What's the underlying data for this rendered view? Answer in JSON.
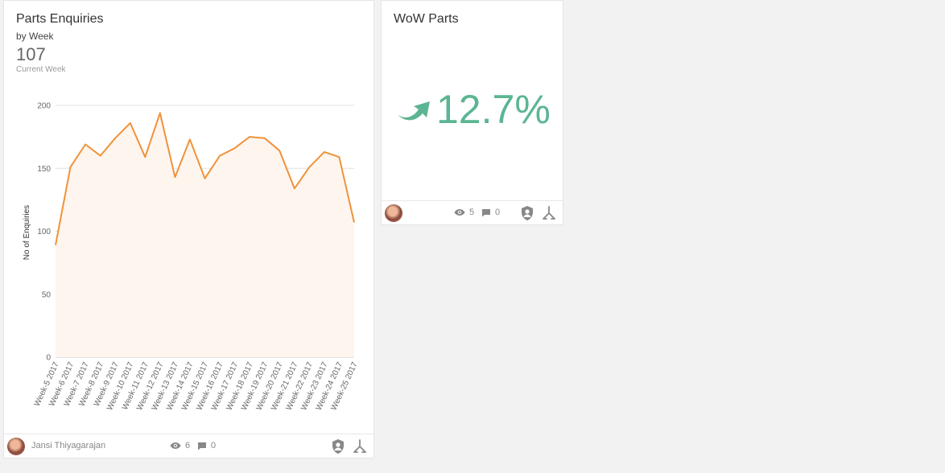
{
  "main_card": {
    "title": "Parts Enquiries",
    "subtitle": "by Week",
    "value": "107",
    "value_caption": "Current Week",
    "footer": {
      "author": "Jansi Thiyagarajan",
      "views": "6",
      "comments": "0",
      "icons": [
        "eye-icon",
        "comment-icon",
        "shield-user-icon",
        "hierarchy-icon"
      ]
    }
  },
  "wow_card": {
    "title": "WoW Parts",
    "value": "12.7%",
    "trend": "up",
    "color": "#5cb592",
    "footer": {
      "views": "5",
      "comments": "0",
      "icons": [
        "eye-icon",
        "comment-icon",
        "shield-user-icon",
        "hierarchy-icon"
      ]
    }
  },
  "chart_data": {
    "type": "area",
    "title": "",
    "xlabel": "",
    "ylabel": "No of Enquiries",
    "ylim": [
      0,
      200
    ],
    "yticks": [
      0,
      50,
      100,
      150,
      200
    ],
    "grid": true,
    "line_color": "#f0923a",
    "fill_color": "#fef5ee",
    "categories": [
      "Week-5 2017",
      "Week-6 2017",
      "Week-7 2017",
      "Week-8 2017",
      "Week-9 2017",
      "Week-10 2017",
      "Week-11 2017",
      "Week-12 2017",
      "Week-13 2017",
      "Week-14 2017",
      "Week-15 2017",
      "Week-16 2017",
      "Week-17 2017",
      "Week-18 2017",
      "Week-19 2017",
      "Week-20 2017",
      "Week-21 2017",
      "Week-22 2017",
      "Week-23 2017",
      "Week-24 2017",
      "Week-25 2017"
    ],
    "values": [
      89,
      151,
      169,
      160,
      174,
      186,
      159,
      194,
      143,
      173,
      142,
      160,
      166,
      175,
      174,
      164,
      134,
      151,
      163,
      159,
      107
    ]
  }
}
